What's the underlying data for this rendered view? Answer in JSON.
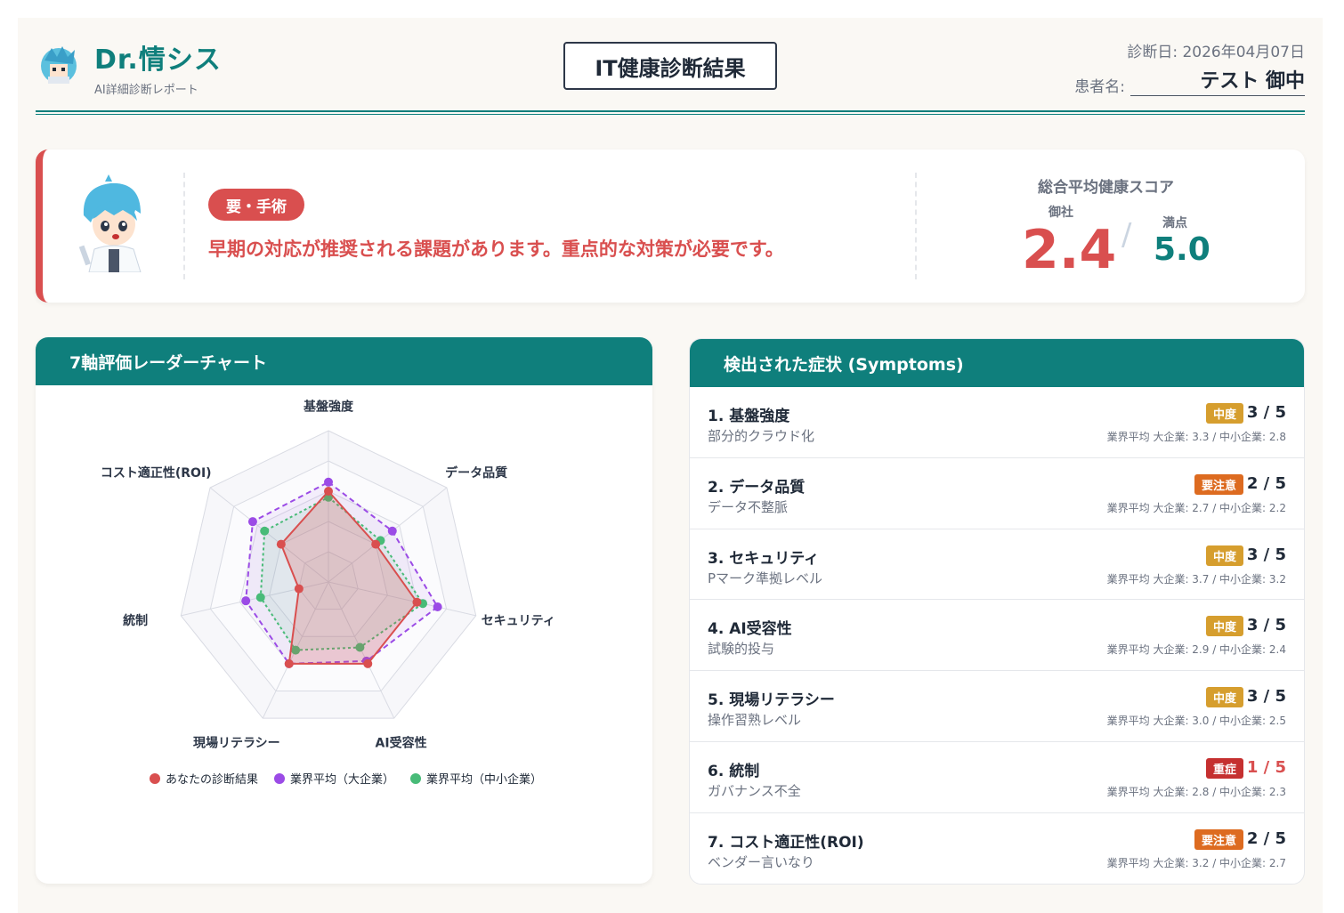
{
  "header": {
    "brand": "Dr.情シス",
    "brand_sub": "AI詳細診断レポート",
    "title": "IT健康診断結果",
    "date_label": "診断日:",
    "date_value": "2026年04月07日",
    "patient_label": "患者名:",
    "patient_value": "テスト 御中"
  },
  "summary": {
    "status": "要・手術",
    "message": "早期の対応が推奨される課題があります。重点的な対策が必要です。",
    "score_title": "総合平均健康スコア",
    "own_label": "御社",
    "own_score": "2.4",
    "slash": "/",
    "max_label": "満点",
    "max_score": "5.0"
  },
  "radar": {
    "title": "7軸評価レーダーチャート"
  },
  "symptoms": {
    "title": "検出された症状 (Symptoms)",
    "items": [
      {
        "name": "1. 基盤強度",
        "detail": "部分的クラウド化",
        "badge": "中度",
        "badge_color": "#d69e2e",
        "score": "3 / 5",
        "score_color": "#1f2937",
        "avg": "業界平均 大企業: 3.3 / 中小企業: 2.8"
      },
      {
        "name": "2. データ品質",
        "detail": "データ不整脈",
        "badge": "要注意",
        "badge_color": "#dd6b20",
        "score": "2 / 5",
        "score_color": "#1f2937",
        "avg": "業界平均 大企業: 2.7 / 中小企業: 2.2"
      },
      {
        "name": "3. セキュリティ",
        "detail": "Pマーク準拠レベル",
        "badge": "中度",
        "badge_color": "#d69e2e",
        "score": "3 / 5",
        "score_color": "#1f2937",
        "avg": "業界平均 大企業: 3.7 / 中小企業: 3.2"
      },
      {
        "name": "4. AI受容性",
        "detail": "試験的投与",
        "badge": "中度",
        "badge_color": "#d69e2e",
        "score": "3 / 5",
        "score_color": "#1f2937",
        "avg": "業界平均 大企業: 2.9 / 中小企業: 2.4"
      },
      {
        "name": "5. 現場リテラシー",
        "detail": "操作習熟レベル",
        "badge": "中度",
        "badge_color": "#d69e2e",
        "score": "3 / 5",
        "score_color": "#1f2937",
        "avg": "業界平均 大企業: 3.0 / 中小企業: 2.5"
      },
      {
        "name": "6. 統制",
        "detail": "ガバナンス不全",
        "badge": "重症",
        "badge_color": "#c53030",
        "score": "1 / 5",
        "score_color": "#d94f4f",
        "avg": "業界平均 大企業: 2.8 / 中小企業: 2.3"
      },
      {
        "name": "7. コスト適正性(ROI)",
        "detail": "ベンダー言いなり",
        "badge": "要注意",
        "badge_color": "#dd6b20",
        "score": "2 / 5",
        "score_color": "#1f2937",
        "avg": "業界平均 大企業: 3.2 / 中小企業: 2.7"
      }
    ]
  },
  "chart_data": {
    "type": "radar",
    "axes": [
      "基盤強度",
      "データ品質",
      "セキュリティ",
      "AI受容性",
      "現場リテラシー",
      "統制",
      "コスト適正性(ROI)"
    ],
    "range": [
      0,
      5
    ],
    "grid_levels": 5,
    "series": [
      {
        "name": "あなたの診断結果",
        "values": [
          3,
          2,
          3,
          3,
          3,
          1,
          2
        ],
        "color": "#d94f4f",
        "dash": "solid"
      },
      {
        "name": "業界平均（大企業）",
        "values": [
          3.3,
          2.7,
          3.7,
          2.9,
          3.0,
          2.8,
          3.2
        ],
        "color": "#9b4be6",
        "dash": "dashed"
      },
      {
        "name": "業界平均（中小企業）",
        "values": [
          2.8,
          2.2,
          3.2,
          2.4,
          2.5,
          2.3,
          2.7
        ],
        "color": "#48bb78",
        "dash": "dotted"
      }
    ],
    "legend_position": "bottom"
  }
}
